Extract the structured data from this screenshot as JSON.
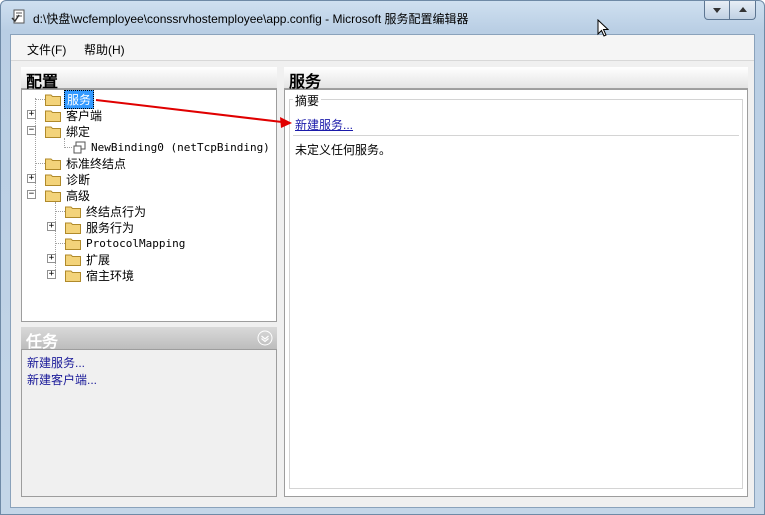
{
  "window": {
    "title": "d:\\快盘\\wcfemployee\\conssrvhostemployee\\app.config - Microsoft 服务配置编辑器"
  },
  "menu": {
    "file": "文件(F)",
    "help": "帮助(H)"
  },
  "left_panel": {
    "title": "配置",
    "tree": {
      "services": "服务",
      "client": "客户端",
      "bindings": "绑定",
      "binding_item": "NewBinding0 (netTcpBinding)",
      "standard_endpoints": "标准终结点",
      "diagnostics": "诊断",
      "advanced": "高级",
      "endpoint_behaviors": "终结点行为",
      "service_behaviors": "服务行为",
      "protocol_mapping": "ProtocolMapping",
      "extensions": "扩展",
      "hosting_environment": "宿主环境"
    }
  },
  "tasks_panel": {
    "title": "任务",
    "links": [
      "新建服务...",
      "新建客户端..."
    ]
  },
  "right_panel": {
    "title": "服务",
    "summary_label": "摘要",
    "new_service_link": "新建服务...",
    "empty_message": "未定义任何服务。"
  },
  "colors": {
    "selection": "#3399ff",
    "annotation_arrow": "#e00000",
    "link": "#1a1aaa"
  }
}
